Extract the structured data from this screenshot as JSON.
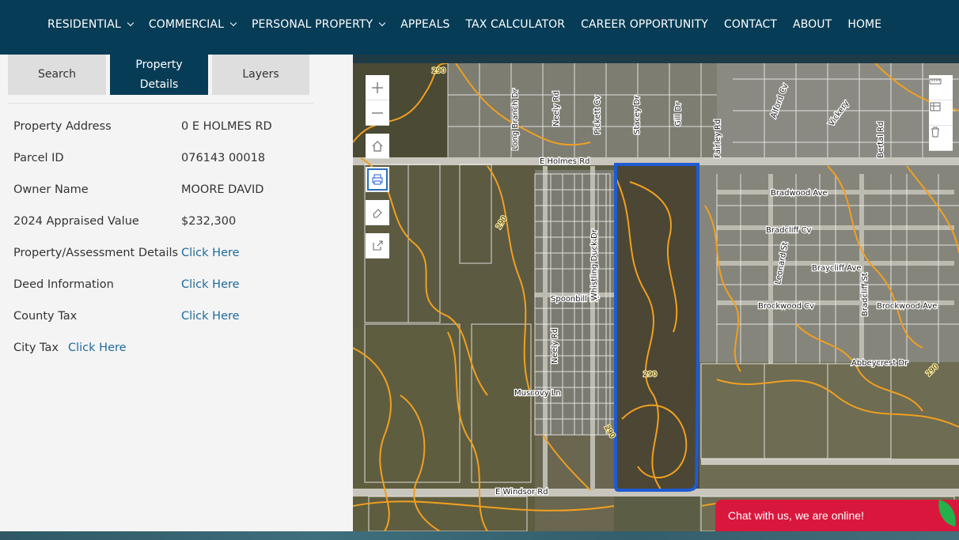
{
  "nav": {
    "items": [
      {
        "label": "RESIDENTIAL",
        "dropdown": true
      },
      {
        "label": "COMMERCIAL",
        "dropdown": true
      },
      {
        "label": "PERSONAL PROPERTY",
        "dropdown": true
      },
      {
        "label": "APPEALS",
        "dropdown": false
      },
      {
        "label": "TAX CALCULATOR",
        "dropdown": false
      },
      {
        "label": "CAREER OPPORTUNITY",
        "dropdown": false
      },
      {
        "label": "CONTACT",
        "dropdown": false
      },
      {
        "label": "ABOUT",
        "dropdown": false
      },
      {
        "label": "HOME",
        "dropdown": false
      }
    ]
  },
  "tabs": {
    "search": "Search",
    "property_details_1": "Property",
    "property_details_2": "Details",
    "layers": "Layers",
    "active": "Property Details"
  },
  "details": {
    "rows": [
      {
        "label": "Property Address",
        "value": "0 E HOLMES RD"
      },
      {
        "label": "Parcel ID",
        "value": "076143 00018"
      },
      {
        "label": "Owner Name",
        "value": "MOORE DAVID"
      },
      {
        "label": "2024 Appraised Value",
        "value": "$232,300"
      },
      {
        "label": "Property/Assessment Details",
        "value": "Click Here"
      },
      {
        "label": "Deed Information",
        "value": "Click Here"
      },
      {
        "label": "County Tax",
        "value": "Click Here"
      },
      {
        "label": "City Tax",
        "value": "Click Here"
      }
    ]
  },
  "map": {
    "streets": [
      "E Holmes Rd",
      "Bradwood Ave",
      "Bradcliff Cv",
      "Braycliff Ave",
      "Brockwood Cv",
      "Brockwood Ave",
      "Spoonbill Dr",
      "Muscovy Ln",
      "E Windsor Rd",
      "Abbeycrest Dr",
      "Neely Rd",
      "Whistling Duck Dr",
      "Long Branch Dr",
      "Pickett Cv",
      "Stacey Dr",
      "Gill Dr",
      "Fairley Rd",
      "Alford Cv",
      "Vickery",
      "Bertal Rd",
      "Leonard St",
      "Bradcliff St"
    ],
    "contour_labels": [
      "290",
      "290",
      "290",
      "290",
      "290"
    ],
    "colors": {
      "parcel_outline": "#1f5bd1",
      "contour": "#f0a020",
      "lot_lines": "#ffffff"
    }
  },
  "chat": {
    "text": "Chat with us, we are online!"
  }
}
